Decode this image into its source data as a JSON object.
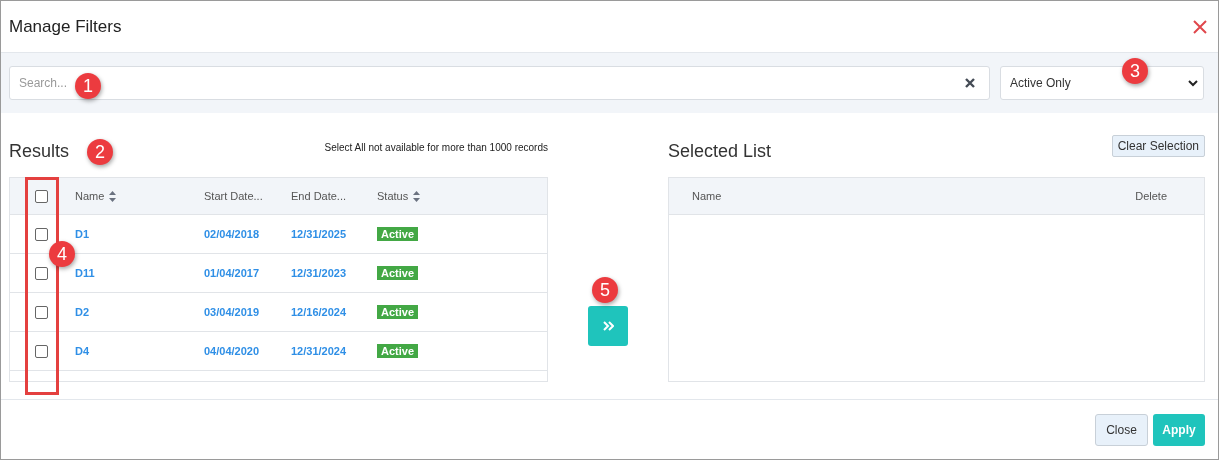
{
  "dialog": {
    "title": "Manage Filters"
  },
  "search": {
    "placeholder": "Search..."
  },
  "status_filter": {
    "value": "Active Only"
  },
  "results": {
    "title": "Results",
    "note": "Select All not available for more than 1000 records",
    "select_all_checked": false,
    "columns": [
      {
        "label": "Name",
        "sortable": true
      },
      {
        "label": "Start Date...",
        "sortable": false
      },
      {
        "label": "End Date...",
        "sortable": false
      },
      {
        "label": "Status",
        "sortable": true
      }
    ],
    "rows": [
      {
        "checked": false,
        "name": "D1",
        "start": "02/04/2018",
        "end": "12/31/2025",
        "status": "Active"
      },
      {
        "checked": false,
        "name": "D11",
        "start": "01/04/2017",
        "end": "12/31/2023",
        "status": "Active"
      },
      {
        "checked": false,
        "name": "D2",
        "start": "03/04/2019",
        "end": "12/16/2024",
        "status": "Active"
      },
      {
        "checked": false,
        "name": "D4",
        "start": "04/04/2020",
        "end": "12/31/2024",
        "status": "Active"
      }
    ]
  },
  "selected_list": {
    "title": "Selected List",
    "clear_button": "Clear Selection",
    "columns": [
      "Name",
      "Delete"
    ]
  },
  "footer": {
    "buttons": [
      {
        "label": "Close",
        "kind": "secondary"
      },
      {
        "label": "Apply",
        "kind": "primary"
      }
    ]
  },
  "annotations": [
    {
      "label": "1"
    },
    {
      "label": "2"
    },
    {
      "label": "3"
    },
    {
      "label": "4"
    },
    {
      "label": "5"
    }
  ]
}
